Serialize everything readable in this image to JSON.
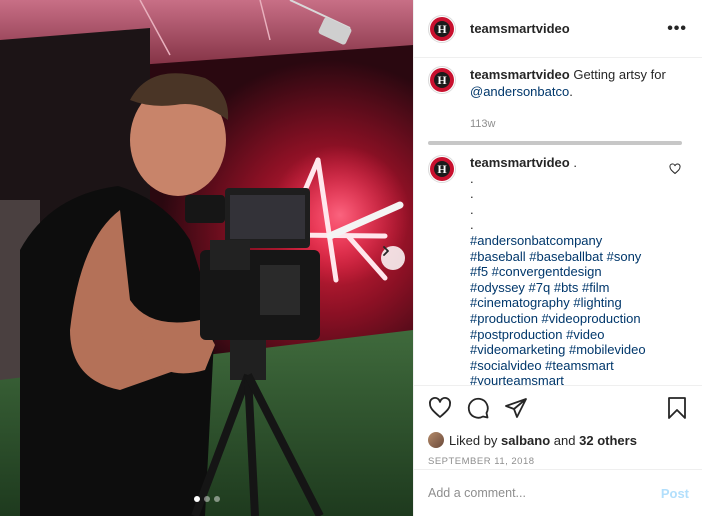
{
  "post": {
    "username": "teamsmartvideo",
    "more_label": "•••",
    "avatar_letter": "H",
    "image_dots": 3,
    "image_active_index": 0
  },
  "caption": {
    "username": "teamsmartvideo",
    "text": "Getting artsy for",
    "mention": "@andersonbatco",
    "trailing": ".",
    "time": "113w"
  },
  "comment": {
    "username": "teamsmartvideo",
    "text": ".",
    "dot_lines": [
      ".",
      ".",
      ".",
      "."
    ],
    "hashtag_lines": [
      "#andersonbatcompany",
      "#baseball #baseballbat #sony",
      "#f5 #convergentdesign",
      "#odyssey #7q #bts #film",
      "#cinematography #lighting",
      "#production #videoproduction",
      "#postproduction #video",
      "#videomarketing #mobilevideo",
      "#socialvideo #teamsmart",
      "#yourteamsmart"
    ]
  },
  "likes": {
    "prefix": "Liked by",
    "user": "salbano",
    "conjunction": "and",
    "others": "32 others"
  },
  "date": "SEPTEMBER 11, 2018",
  "add_comment": {
    "placeholder": "Add a comment...",
    "post_label": "Post"
  },
  "colors": {
    "link": "#00376b",
    "muted": "#8e8e8e",
    "post_disabled": "#b2dffc",
    "brand_red": "#c8102e"
  },
  "icons": [
    "chevron-right-icon",
    "ellipsis-icon",
    "heart-icon",
    "comment-icon",
    "share-icon",
    "bookmark-icon"
  ]
}
